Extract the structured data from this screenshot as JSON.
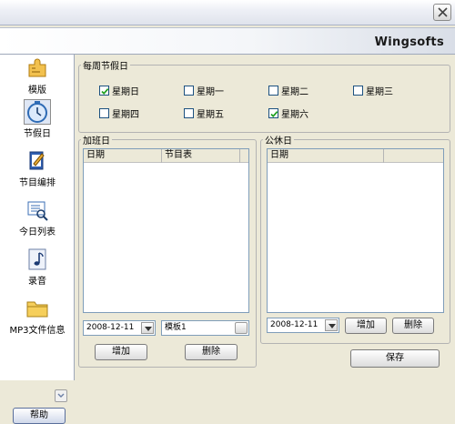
{
  "header": {
    "brand": "Wingsofts"
  },
  "sidebar": {
    "items": [
      {
        "label": "模版",
        "icon": "template-puzzle-icon"
      },
      {
        "label": "节假日",
        "icon": "clock-icon"
      },
      {
        "label": "节目编排",
        "icon": "schedule-edit-icon"
      },
      {
        "label": "今日列表",
        "icon": "search-list-icon"
      },
      {
        "label": "录音",
        "icon": "music-note-icon"
      },
      {
        "label": "MP3文件信息",
        "icon": "folder-icon"
      }
    ],
    "help_label": "帮助"
  },
  "weekly": {
    "legend": "每周节假日",
    "days": [
      {
        "label": "星期日",
        "checked": true
      },
      {
        "label": "星期一",
        "checked": false
      },
      {
        "label": "星期二",
        "checked": false
      },
      {
        "label": "星期三",
        "checked": false
      },
      {
        "label": "星期四",
        "checked": false
      },
      {
        "label": "星期五",
        "checked": false
      },
      {
        "label": "星期六",
        "checked": true
      }
    ]
  },
  "overtime": {
    "legend": "加班日",
    "columns": [
      "日期",
      "节目表"
    ],
    "date_value": "2008-12-11",
    "template_value": "模板1",
    "add_label": "增加",
    "delete_label": "删除"
  },
  "holiday": {
    "legend": "公休日",
    "columns": [
      "日期"
    ],
    "date_value": "2008-12-11",
    "add_label": "增加",
    "delete_label": "删除"
  },
  "save_label": "保存"
}
